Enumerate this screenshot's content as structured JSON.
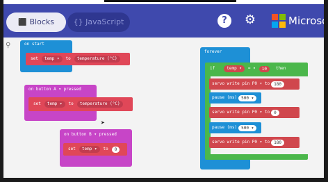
{
  "tabs": {
    "blocks_label": "Blocks",
    "blocks_icon": "puzzle-piece-icon",
    "js_label": "{} JavaScript"
  },
  "header": {
    "help_label": "?",
    "settings_icon": "gear-icon",
    "brand": "Microsoft",
    "colors": {
      "bar": "#3f49ad",
      "tab_active": "#ebebf5"
    }
  },
  "blocks": {
    "on_start": {
      "hat": "on start",
      "set_kw": "set",
      "var": "temp ▾",
      "to_kw": "to",
      "value": "temperature (°C)",
      "colors": {
        "event": "#1e90d6",
        "variables": "#e04758",
        "input": "#c23c4e"
      }
    },
    "on_button_a": {
      "hat": "on button A ▾ pressed",
      "set_kw": "set",
      "var": "temp ▾",
      "to_kw": "to",
      "value": "temperature (°C)",
      "colors": {
        "event": "#c745c7",
        "variables": "#e04758"
      }
    },
    "on_button_b": {
      "hat": "on button B ▾ pressed",
      "set_kw": "set",
      "var": "temp ▾",
      "to_kw": "to",
      "value": "0"
    },
    "forever": {
      "hat": "forever",
      "if_kw": "if",
      "cond_var": "temp ▾",
      "cond_op": "= ▾",
      "cond_val": "10",
      "then_kw": "then",
      "lines": [
        {
          "text": "servo write pin P0 ▾ to",
          "value": "180"
        },
        {
          "text": "pause (ms)",
          "value": "500 ▾"
        },
        {
          "text": "servo write pin P0 ▾ to",
          "value": "0"
        },
        {
          "text": "pause (ms)",
          "value": "500 ▾"
        },
        {
          "text": "servo write pin P0 ▾ to",
          "value": "180"
        }
      ],
      "add_icon": "plus-icon",
      "colors": {
        "event": "#1e90d6",
        "logic": "#4bb74b",
        "pins": "#d0474d",
        "basic": "#1e90d6"
      }
    }
  }
}
